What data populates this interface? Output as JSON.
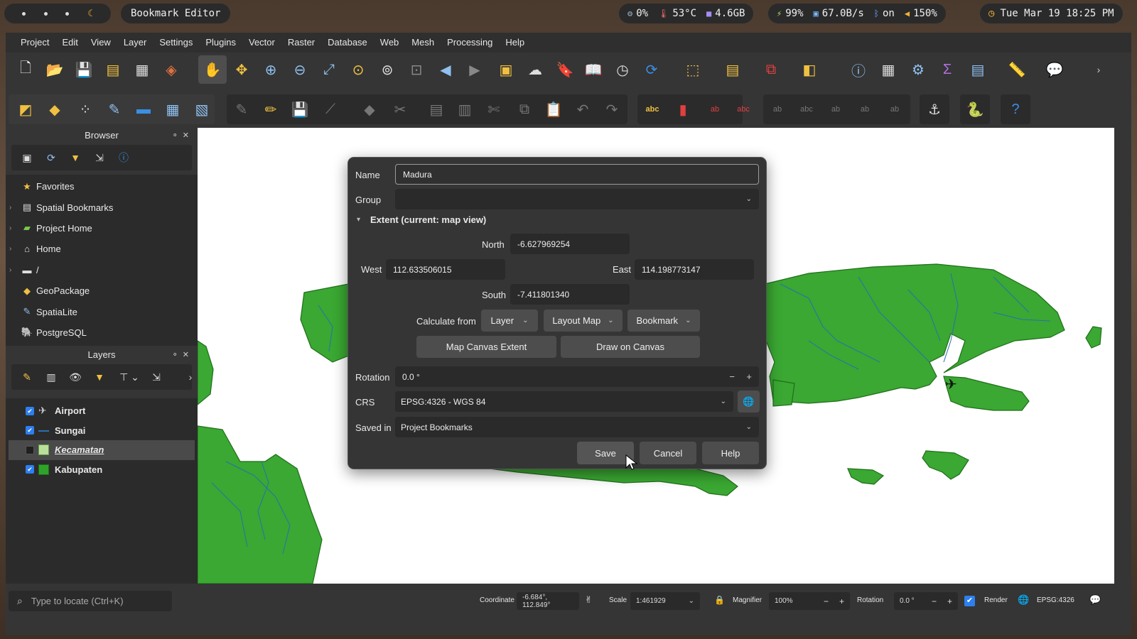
{
  "system_bar": {
    "window_title": "Bookmark Editor",
    "cpu": "0%",
    "temperature": "53°C",
    "memory": "4.6GB",
    "battery": "99%",
    "network": "67.0B/s",
    "bluetooth": "on",
    "volume": "150%",
    "clock": "Tue Mar 19 18:25 PM"
  },
  "menu": [
    "Project",
    "Edit",
    "View",
    "Layer",
    "Settings",
    "Plugins",
    "Vector",
    "Raster",
    "Database",
    "Web",
    "Mesh",
    "Processing",
    "Help"
  ],
  "browser": {
    "title": "Browser",
    "items": [
      {
        "label": "Favorites",
        "icon": "star-icon",
        "expandable": false
      },
      {
        "label": "Spatial Bookmarks",
        "icon": "bookmark-icon",
        "expandable": true
      },
      {
        "label": "Project Home",
        "icon": "project-home-icon",
        "expandable": true
      },
      {
        "label": "Home",
        "icon": "home-folder-icon",
        "expandable": true
      },
      {
        "label": "/",
        "icon": "folder-icon",
        "expandable": true
      },
      {
        "label": "GeoPackage",
        "icon": "geopackage-icon",
        "expandable": false
      },
      {
        "label": "SpatiaLite",
        "icon": "spatialite-icon",
        "expandable": false
      },
      {
        "label": "PostgreSQL",
        "icon": "postgresql-icon",
        "expandable": false
      }
    ]
  },
  "layers": {
    "title": "Layers",
    "items": [
      {
        "label": "Airport",
        "checked": true,
        "symbol": "airport-icon"
      },
      {
        "label": "Sungai",
        "checked": true,
        "symbol": "line-symbol"
      },
      {
        "label": "Kecamatan",
        "checked": false,
        "symbol": "polygon-light-green"
      },
      {
        "label": "Kabupaten",
        "checked": true,
        "symbol": "polygon-green"
      }
    ]
  },
  "dialog": {
    "name_label": "Name",
    "name_value": "Madura",
    "group_label": "Group",
    "group_value": "",
    "extent_header": "Extent (current: map view)",
    "north_label": "North",
    "north_value": "-6.627969254",
    "west_label": "West",
    "west_value": "112.633506015",
    "east_label": "East",
    "east_value": "114.198773147",
    "south_label": "South",
    "south_value": "-7.411801340",
    "calculate_label": "Calculate from",
    "calc_layer": "Layer",
    "calc_layout_map": "Layout Map",
    "calc_bookmark": "Bookmark",
    "map_canvas_extent": "Map Canvas Extent",
    "draw_on_canvas": "Draw on Canvas",
    "rotation_label": "Rotation",
    "rotation_value": "0.0 °",
    "crs_label": "CRS",
    "crs_value": "EPSG:4326 - WGS 84",
    "saved_in_label": "Saved in",
    "saved_in_value": "Project Bookmarks",
    "save": "Save",
    "cancel": "Cancel",
    "help": "Help"
  },
  "statusbar": {
    "locator_placeholder": "Type to locate (Ctrl+K)",
    "coordinate_label": "Coordinate",
    "coordinate_value": "-6.684°, 112.849°",
    "scale_label": "Scale",
    "scale_value": "1:461929",
    "magnifier_label": "Magnifier",
    "magnifier_value": "100%",
    "rotation_label": "Rotation",
    "rotation_value": "0.0 °",
    "render_label": "Render",
    "crs_value": "EPSG:4326"
  },
  "colors": {
    "land": "#3aa832",
    "land_border": "#1f6e1a",
    "river": "#2a6fb0",
    "accent": "#2d7ff0"
  }
}
